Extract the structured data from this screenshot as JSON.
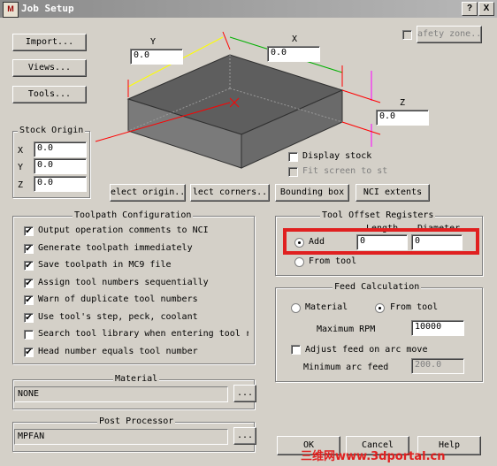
{
  "window": {
    "title": "Job Setup",
    "help_glyph": "?",
    "close_glyph": "X"
  },
  "left_buttons": {
    "import": "Import...",
    "views": "Views...",
    "tools": "Tools..."
  },
  "safety_zone": {
    "label": "afety zone..."
  },
  "dims": {
    "x_label": "X",
    "x_value": "0.0",
    "y_label": "Y",
    "y_value": "0.0",
    "z_label": "Z",
    "z_value": "0.0"
  },
  "stock_origin": {
    "title": "Stock Origin",
    "x_label": "X",
    "x_value": "0.0",
    "y_label": "Y",
    "y_value": "0.0",
    "z_label": "Z",
    "z_value": "0.0"
  },
  "display": {
    "display_stock": "Display stock",
    "fit_screen": "Fit screen to st"
  },
  "stock_buttons": {
    "select_origin": "elect origin..",
    "select_corners": "lect corners..",
    "bounding_box": "Bounding box",
    "nci_extents": "NCI extents"
  },
  "toolpath_config": {
    "title": "Toolpath Configuration",
    "items": [
      {
        "label": "Output operation comments to NCI",
        "checked": true
      },
      {
        "label": "Generate toolpath immediately",
        "checked": true
      },
      {
        "label": "Save toolpath in MC9 file",
        "checked": true
      },
      {
        "label": "Assign tool numbers sequentially",
        "checked": true
      },
      {
        "label": "Warn of duplicate tool numbers",
        "checked": true
      },
      {
        "label": "Use tool's step, peck, coolant",
        "checked": true
      },
      {
        "label": "Search tool library when entering tool r",
        "checked": false
      },
      {
        "label": "Head number equals tool number",
        "checked": true
      }
    ]
  },
  "tool_offset": {
    "title": "Tool Offset Registers",
    "length_label": "Length",
    "diameter_label": "Diameter",
    "add_label": "Add",
    "length_value": "0",
    "diameter_value": "0",
    "from_tool_label": "From tool",
    "highlight_color": "#e02020"
  },
  "feed": {
    "title": "Feed Calculation",
    "material_label": "Material",
    "from_tool_label": "From tool",
    "max_rpm_label": "Maximum RPM",
    "max_rpm_value": "10000",
    "adjust_label": "Adjust feed on arc move",
    "min_arc_label": "Minimum arc feed",
    "min_arc_value": "200.0"
  },
  "material": {
    "title": "Material",
    "value": "NONE",
    "browse": "..."
  },
  "post": {
    "title": "Post Processor",
    "value": "MPFAN",
    "browse": "..."
  },
  "footer": {
    "ok": "OK",
    "cancel": "Cancel",
    "help": "Help"
  },
  "watermark": "三维网www.3dportal.cn"
}
